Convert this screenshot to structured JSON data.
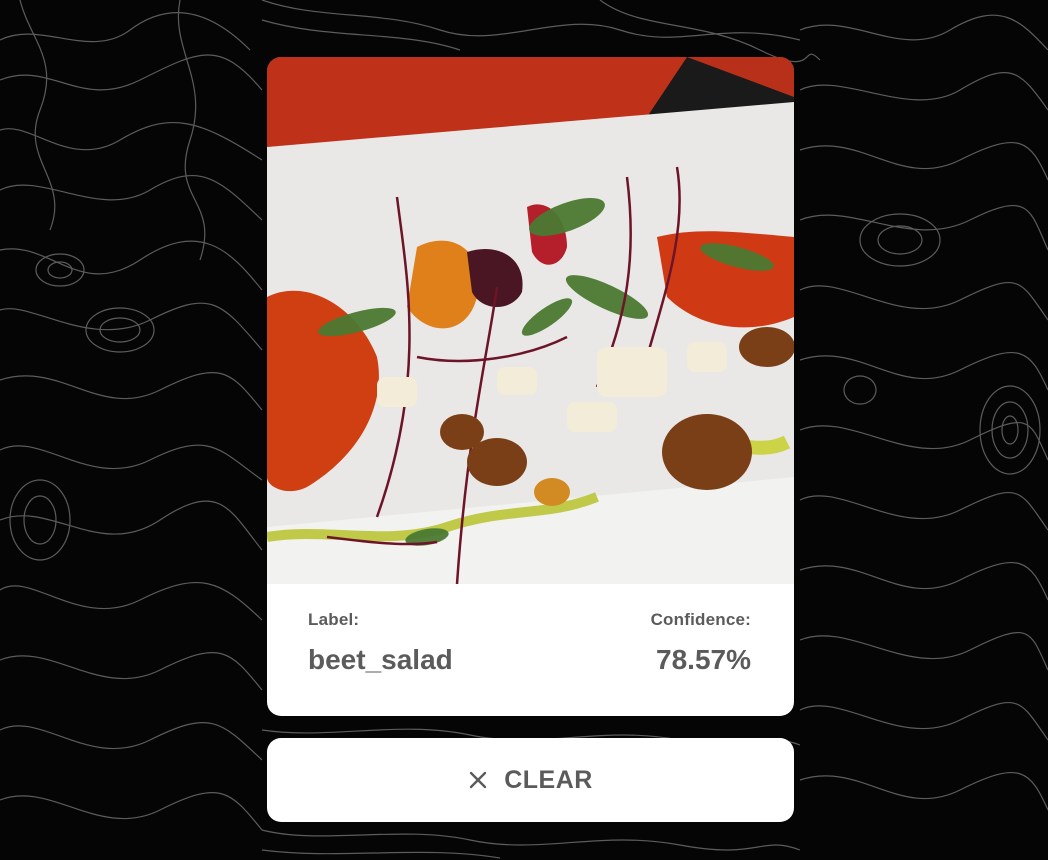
{
  "result": {
    "label_caption": "Label:",
    "label_value": "beet_salad",
    "confidence_caption": "Confidence:",
    "confidence_value": "78.57%"
  },
  "clear_button": {
    "label": "CLEAR",
    "icon": "close-icon"
  },
  "colors": {
    "background": "#050505",
    "contour_lines": "#8a8a8a",
    "card": "#ffffff",
    "text": "#5b5b5b"
  }
}
